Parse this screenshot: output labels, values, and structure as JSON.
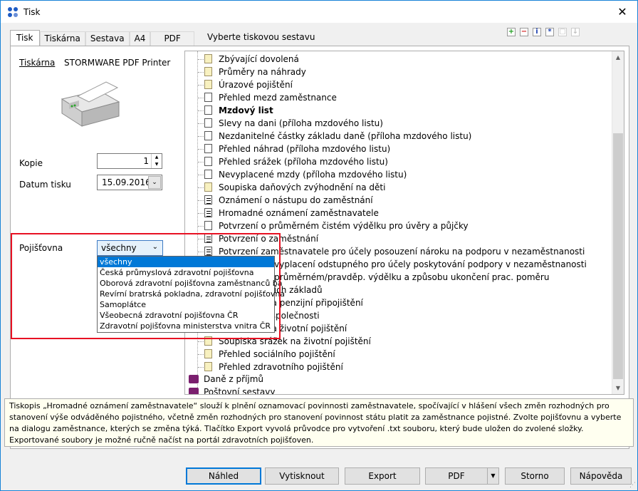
{
  "window": {
    "title": "Tisk",
    "close_label": "✕"
  },
  "tabs": [
    "Tisk",
    "Tiskárna",
    "Sestava",
    "A4",
    "PDF"
  ],
  "heading": "Vyberte tiskovou sestavu",
  "toolbar_icons": [
    "add-report-icon",
    "remove-report-icon",
    "info-icon",
    "properties-icon",
    "copy-icon",
    "download-icon"
  ],
  "printer": {
    "label": "Tiskárna",
    "value": "STORMWARE PDF Printer"
  },
  "copies": {
    "label": "Kopie",
    "value": "1"
  },
  "print_date": {
    "label": "Datum tisku",
    "value": "15.09.2016"
  },
  "insurer": {
    "label": "Pojišťovna",
    "selected": "všechny",
    "options": [
      "všechny",
      "Česká průmyslová zdravotní pojišťovna",
      "Oborová zdravotní pojišťovna zaměstnanců ba",
      "Revírní bratrská pokladna, zdravotní pojišťovna",
      "Samoplátce",
      "Všeobecná zdravotní pojišťovna ČR",
      "Zdravotní pojišťovna ministerstva vnitra ČR"
    ]
  },
  "reports": [
    {
      "text": "Zbývající dovolená",
      "icon": "yellow"
    },
    {
      "text": "Průměry na náhrady",
      "icon": "yellow"
    },
    {
      "text": "Úrazové pojištění",
      "icon": "yellow"
    },
    {
      "text": "Přehled mezd zaměstnance",
      "icon": "white"
    },
    {
      "text": "Mzdový list",
      "icon": "white",
      "bold": true
    },
    {
      "text": "Slevy na dani (příloha mzdového listu)",
      "icon": "white"
    },
    {
      "text": "Nezdanitelné částky základu daně (příloha mzdového listu)",
      "icon": "white"
    },
    {
      "text": "Přehled náhrad (příloha mzdového listu)",
      "icon": "white"
    },
    {
      "text": "Přehled srážek (příloha mzdového listu)",
      "icon": "white"
    },
    {
      "text": "Nevyplacené mzdy (příloha mzdového listu)",
      "icon": "white"
    },
    {
      "text": "Soupiska daňových zvýhodnění na děti",
      "icon": "yellow"
    },
    {
      "text": "Oznámení o nástupu do zaměstnání",
      "icon": "lined"
    },
    {
      "text": "Hromadné oznámení zaměstnavatele",
      "icon": "lined"
    },
    {
      "text": "Potvrzení o průměrném čistém výdělku pro úvěry a půjčky",
      "icon": "white"
    },
    {
      "text": "Potvrzení o zaměstnání",
      "icon": "lined"
    },
    {
      "text": "Potvrzení zaměstnavatele pro účely posouzení nároku na podporu v nezaměstnanosti",
      "icon": "lined"
    },
    {
      "text": "stnavatele o vyplacení odstupného pro účely poskytování podpory v nezaměstnanosti",
      "icon": "white"
    },
    {
      "text": "stnavatele o průměrném/pravděp. výdělku a způsobu ukončení prac. poměru",
      "icon": "white"
    },
    {
      "text": "u vyměřovacích základů",
      "icon": "white"
    },
    {
      "text": "stnavatele na penzijní připojištění",
      "icon": "white"
    },
    {
      "text": "pro penzijní společnosti",
      "icon": "white"
    },
    {
      "text": "stnavatele na životní pojištění",
      "icon": "white"
    },
    {
      "text": "Soupiska srážek na životní pojištění",
      "icon": "yellow"
    },
    {
      "text": "Přehled sociálního pojištění",
      "icon": "yellow"
    },
    {
      "text": "Přehled zdravotního pojištění",
      "icon": "yellow"
    }
  ],
  "groups": [
    "Daně z příjmů",
    "Poštovní sestavy"
  ],
  "description": "Tiskopis „Hromadné oznámení zaměstnavatele“ slouží k plnění oznamovací povinnosti zaměstnavatele, spočívající v hlášení všech změn rozhodných pro stanovení výše odváděného pojistného, včetně změn rozhodných pro stanovení povinnost státu platit za zaměstnance pojistné. Zvolte pojišťovnu a vyberte na dialogu zaměstnance, kterých se změna týká. Tlačítko Export vyvolá průvodce pro vytvoření .txt souboru, který bude uložen do zvolené složky. Exportované soubory je možné ručně načíst na portál zdravotních pojišťoven.",
  "buttons": {
    "preview": "Náhled",
    "print": "Vytisknout",
    "export": "Export",
    "pdf": "PDF",
    "cancel": "Storno",
    "help": "Nápověda"
  }
}
